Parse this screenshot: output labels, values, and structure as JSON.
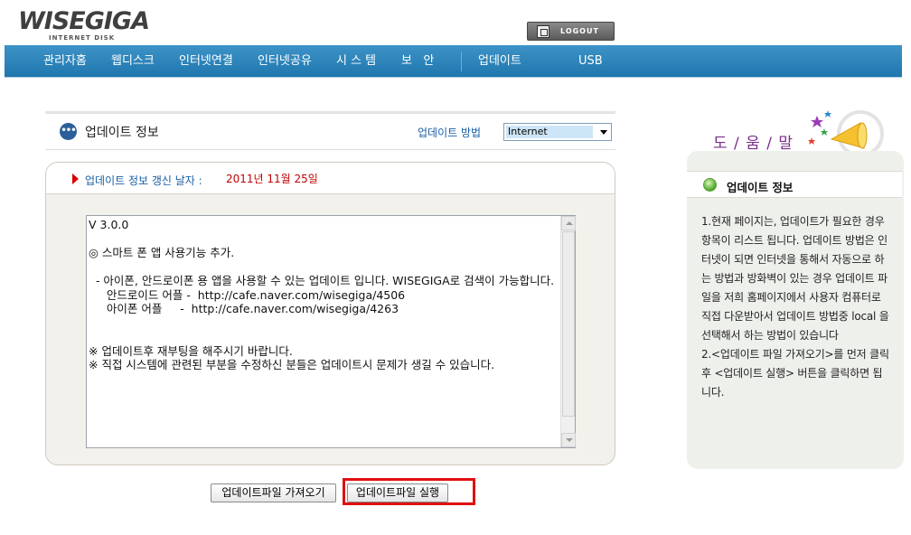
{
  "header": {
    "logo": "WISEGIGA",
    "logo_sub": "INTERNET DISK",
    "logout_label": "LOGOUT"
  },
  "nav": {
    "items": [
      {
        "label": "관리자홈"
      },
      {
        "label": "웹디스크"
      },
      {
        "label": "인터넷연결"
      },
      {
        "label": "인터넷공유"
      },
      {
        "label": "시 스 템"
      },
      {
        "label": "보   안"
      },
      {
        "label": "업데이트"
      },
      {
        "label": "USB"
      }
    ]
  },
  "section": {
    "title": "업데이트 정보",
    "method_label": "업데이트 방법",
    "method_value": "Internet"
  },
  "panel": {
    "date_label": "업데이트 정보 갱신 날자 :",
    "date_value": "2011년 11월 25일",
    "content": "V 3.0.0\n\n◎ 스마트 폰 앱 사용기능 추가.\n\n  - 아이폰, 안드로이폰 용 앱을 사용할 수 있는 업데이트 입니다. WISEGIGA로 검색이 가능합니다.\n     안드로이드 어플 -  http://cafe.naver.com/wisegiga/4506\n     아이폰 어플     -  http://cafe.naver.com/wisegiga/4263\n\n\n※ 업데이트후 재부팅을 해주시기 바랍니다.\n※ 직접 시스템에 관련된 부분을 수정하신 분들은 업데이트시 문제가 생길 수 있습니다."
  },
  "buttons": {
    "fetch": "업데이트파일 가져오기",
    "run": "업데이트파일 실행"
  },
  "help": {
    "title": "도 / 움 / 말",
    "head": "업데이트 정보",
    "body": "1.현재 페이지는, 업데이트가 필요한 경우 항목이 리스트 됩니다. 업데이트 방법은 인터넷이 되면 인터넷을 통해서 자동으로 하는 방법과 방화벽이 있는 경우 업데이트 파일을 저희 홈페이지에서 사용자 컴퓨터로 직접 다운받아서 업데이트 방법중 local 을 선택해서 하는 방법이 있습니다\n2.<업데이트 파일 가져오기>를 먼저 클릭후 <업데이트 실행> 버튼을 클릭하면 됩니다."
  },
  "colors": {
    "nav_bg": "#2a85bd",
    "highlight": "#e01010",
    "date_red": "#c00000",
    "link_blue": "#1a5fa6"
  }
}
